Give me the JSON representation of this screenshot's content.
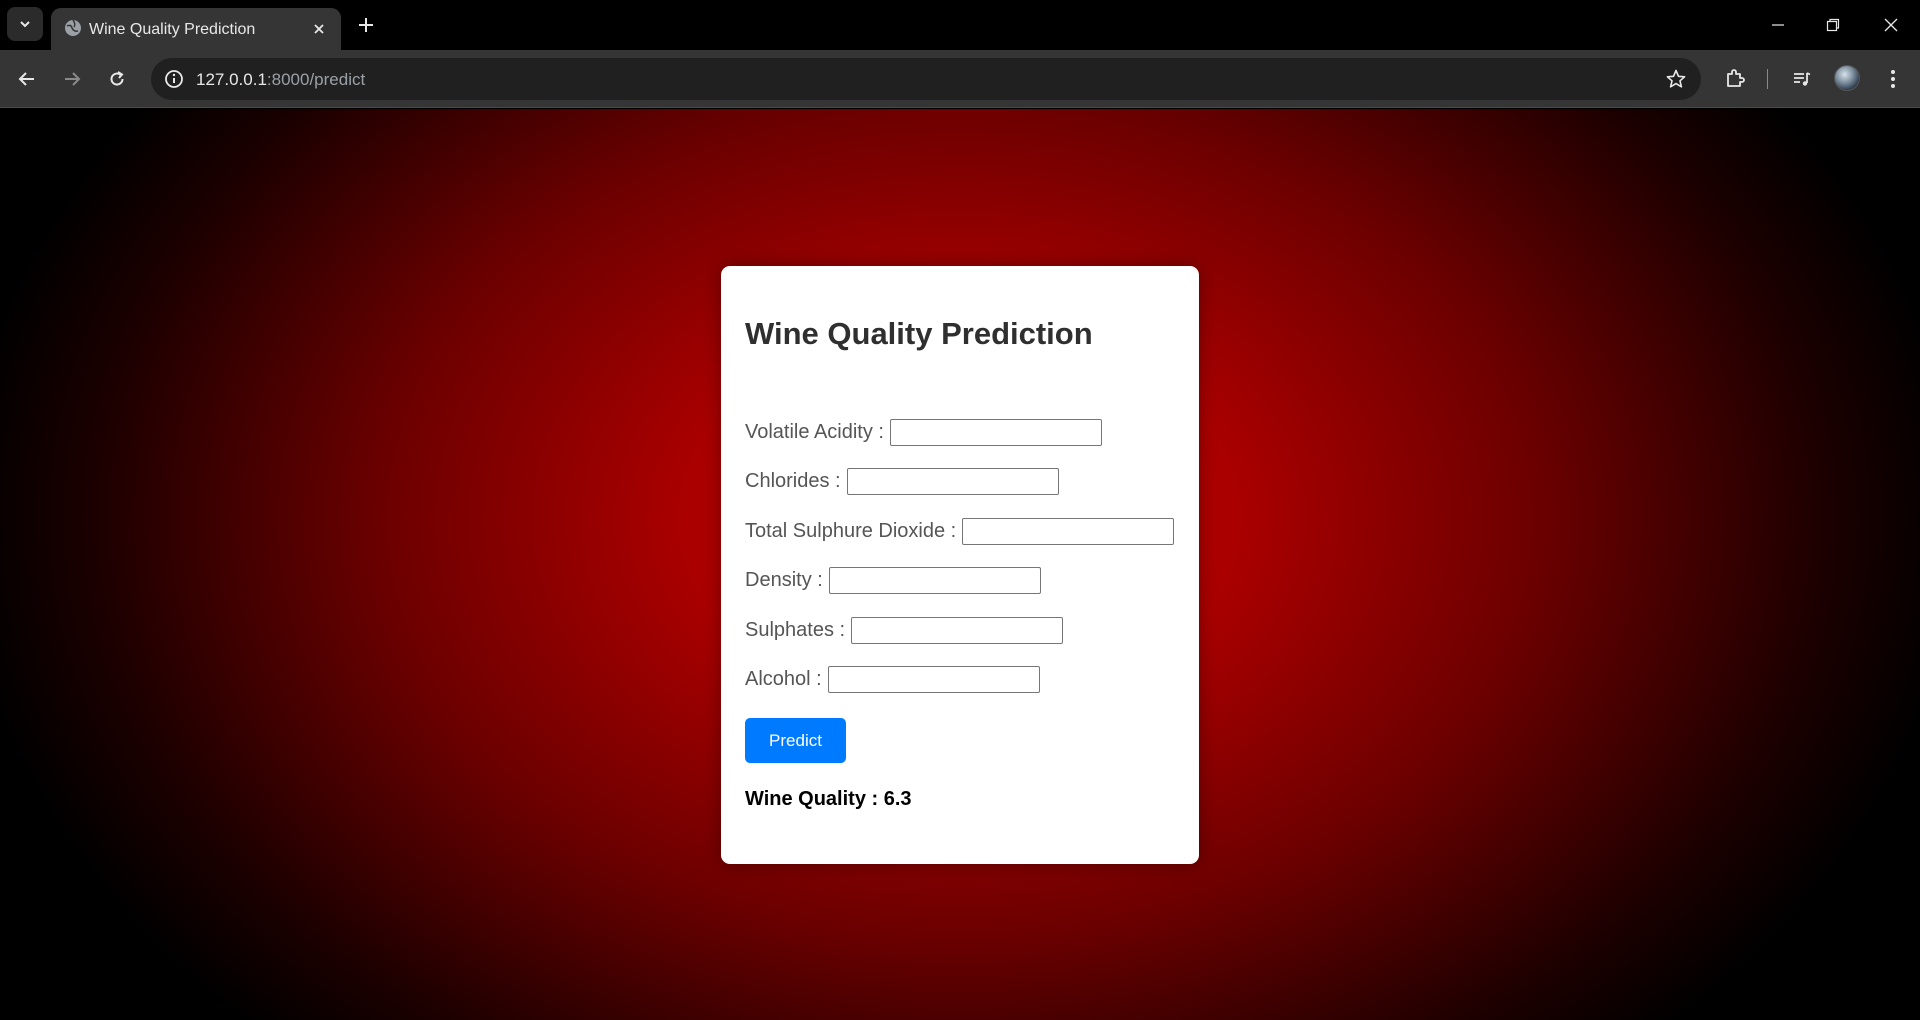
{
  "browser": {
    "tab": {
      "title": "Wine Quality Prediction"
    },
    "address": {
      "host": "127.0.0.1",
      "path": ":8000/predict"
    }
  },
  "page": {
    "heading": "Wine Quality Prediction",
    "fields": [
      {
        "label": "Volatile Acidity :",
        "value": ""
      },
      {
        "label": "Chlorides :",
        "value": ""
      },
      {
        "label": "Total Sulphure Dioxide :",
        "value": ""
      },
      {
        "label": "Density :",
        "value": ""
      },
      {
        "label": "Sulphates :",
        "value": ""
      },
      {
        "label": "Alcohol :",
        "value": ""
      }
    ],
    "predict_label": "Predict",
    "result": "Wine Quality : 6.3"
  },
  "colors": {
    "accent": "#007bff",
    "background_center": "#c90000",
    "background_edge": "#000000"
  },
  "icons": [
    "chevron-down-icon",
    "globe-icon",
    "close-icon",
    "plus-icon",
    "minimize-icon",
    "restore-icon",
    "back-arrow-icon",
    "forward-arrow-icon",
    "reload-icon",
    "info-icon",
    "star-icon",
    "extensions-icon",
    "media-controls-icon",
    "more-vert-icon"
  ]
}
